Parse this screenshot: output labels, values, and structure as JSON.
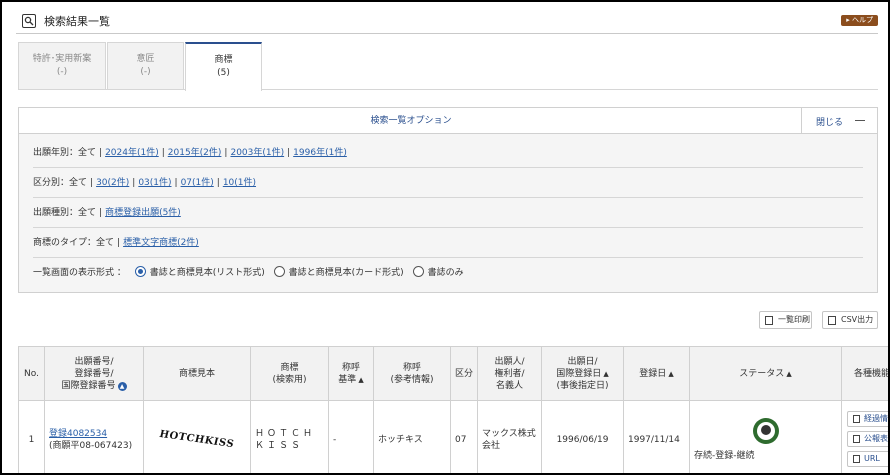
{
  "header": {
    "title": "検索結果一覧",
    "help_label": "ヘルプ"
  },
  "tabs": [
    {
      "label": "特許･実用新案",
      "count": "(-)"
    },
    {
      "label": "意匠",
      "count": "(-)"
    },
    {
      "label": "商標",
      "count": "(5)",
      "active": true
    }
  ],
  "options": {
    "title": "検索一覧オプション",
    "close_label": "閉じる",
    "filing_year": {
      "label": "出願年別：全て",
      "links": [
        "2024年(1件)",
        "2015年(2件)",
        "2003年(1件)",
        "1996年(1件)"
      ]
    },
    "class": {
      "label": "区分別：全て",
      "links": [
        "30(2件)",
        "03(1件)",
        "07(1件)",
        "10(1件)"
      ]
    },
    "filing_type": {
      "label": "出願種別：全て",
      "links": [
        "商標登録出願(5件)"
      ]
    },
    "mark_type": {
      "label": "商標のタイプ：全て",
      "links": [
        "標準文字商標(2件)"
      ]
    },
    "display": {
      "label": "一覧画面の表示形式 ：",
      "choices": [
        "書誌と商標見本(リスト形式)",
        "書誌と商標見本(カード形式)",
        "書誌のみ"
      ],
      "selected": 0
    }
  },
  "actions": {
    "print_label": "一覧印刷",
    "csv_label": "CSV出力"
  },
  "table": {
    "headers": {
      "no": "No.",
      "num_1": "出願番号/",
      "num_2": "登録番号/",
      "num_3": "国際登録番号",
      "sample": "商標見本",
      "mark_1": "商標",
      "mark_2": "(検索用)",
      "shoko_1": "称呼",
      "shoko_2": "基準",
      "ref_1": "称呼",
      "ref_2": "(参考情報)",
      "class": "区分",
      "app_1": "出願人/",
      "app_2": "権利者/",
      "app_3": "名義人",
      "date_1": "出願日/",
      "date_2": "国際登録日",
      "date_3": "(事後指定日)",
      "reg": "登録日",
      "status": "ステータス",
      "funcs": "各種機能"
    },
    "rows": [
      {
        "no": "1",
        "reg_link": "登録4082534",
        "app_no": "(商願平08-067423)",
        "sample_text": "HOTCHKISS",
        "mark": "ＨＯＴＣＨＫＩＳＳ",
        "shoko": "-",
        "reference": "ホッチキス",
        "class": "07",
        "applicant": "マックス株式会社",
        "filing_date": "1996/06/19",
        "reg_date": "1997/11/14",
        "status": "存続-登録-継続",
        "buttons": [
          "経過情報",
          "公報表示",
          "URL"
        ]
      }
    ]
  },
  "colors": {
    "accent": "#2a4f8e",
    "link": "#2a5fa8",
    "help": "#8b4d1d",
    "status_badge": "#2e6b2e"
  }
}
